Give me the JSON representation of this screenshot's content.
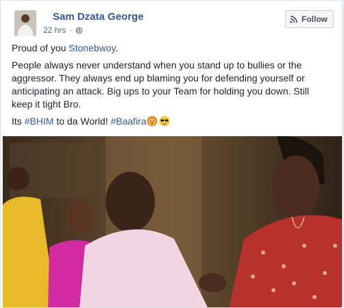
{
  "post": {
    "author": "Sam Dzata George",
    "time": "22 hrs",
    "privacy_icon": "globe-icon",
    "follow_label": "Follow",
    "follow_icon": "rss-icon",
    "line1_prefix": "Proud of you ",
    "mention": "Stonebwoy",
    "line1_suffix": ".",
    "paragraph": "People always never understand when you stand up to bullies or the aggressor. They always end up blaming you for defending yourself or anticipating an attack. Big ups to your Team for holding you down. Still keep it tight Bro.",
    "line3_prefix": "Its ",
    "hashtag1": "#BHIM",
    "line3_mid": " to da World! ",
    "hashtag2": "#Baafira",
    "emojis": [
      "lion-face-emoji",
      "sunglasses-face-emoji"
    ]
  },
  "colors": {
    "link": "#365899",
    "text": "#1d2129",
    "meta": "#616770"
  }
}
